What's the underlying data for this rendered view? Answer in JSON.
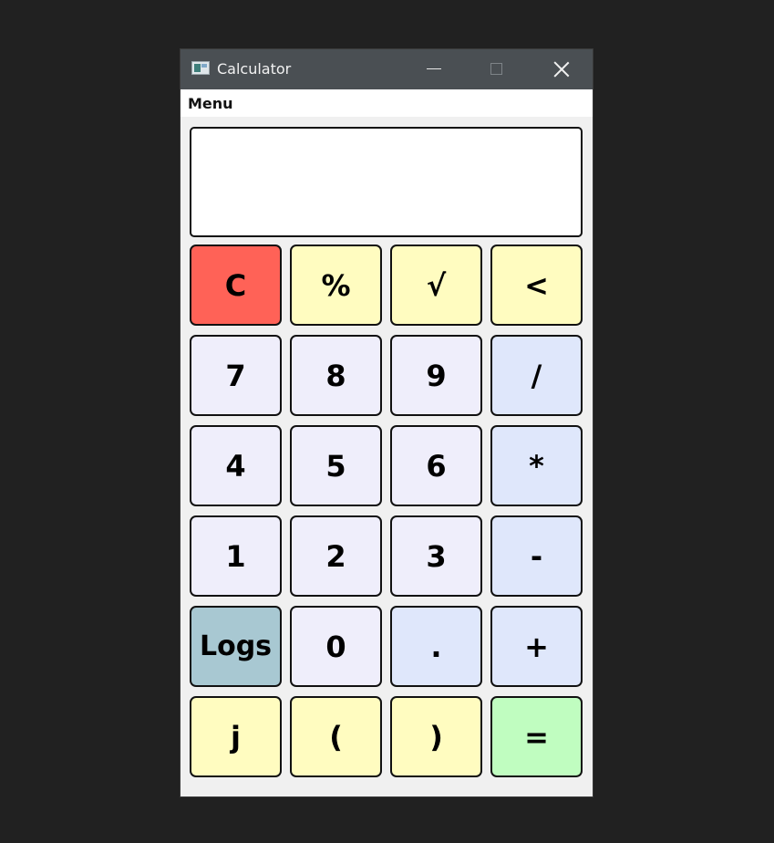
{
  "window": {
    "title": "Calculator",
    "icon": "calculator-app-icon"
  },
  "menubar": {
    "items": [
      "Menu"
    ]
  },
  "display": {
    "value": ""
  },
  "colors": {
    "clear": "#ff6257",
    "function": "#fffcc0",
    "digit": "#efeefb",
    "operator": "#dfe7fb",
    "logs": "#a8c8d2",
    "equals": "#c0fdc0"
  },
  "keypad": {
    "rows": [
      [
        "C",
        "%",
        "√",
        "<"
      ],
      [
        "7",
        "8",
        "9",
        "/"
      ],
      [
        "4",
        "5",
        "6",
        "*"
      ],
      [
        "1",
        "2",
        "3",
        "-"
      ],
      [
        "Logs",
        "0",
        ".",
        "+"
      ],
      [
        "j",
        "(",
        ")",
        "="
      ]
    ]
  }
}
